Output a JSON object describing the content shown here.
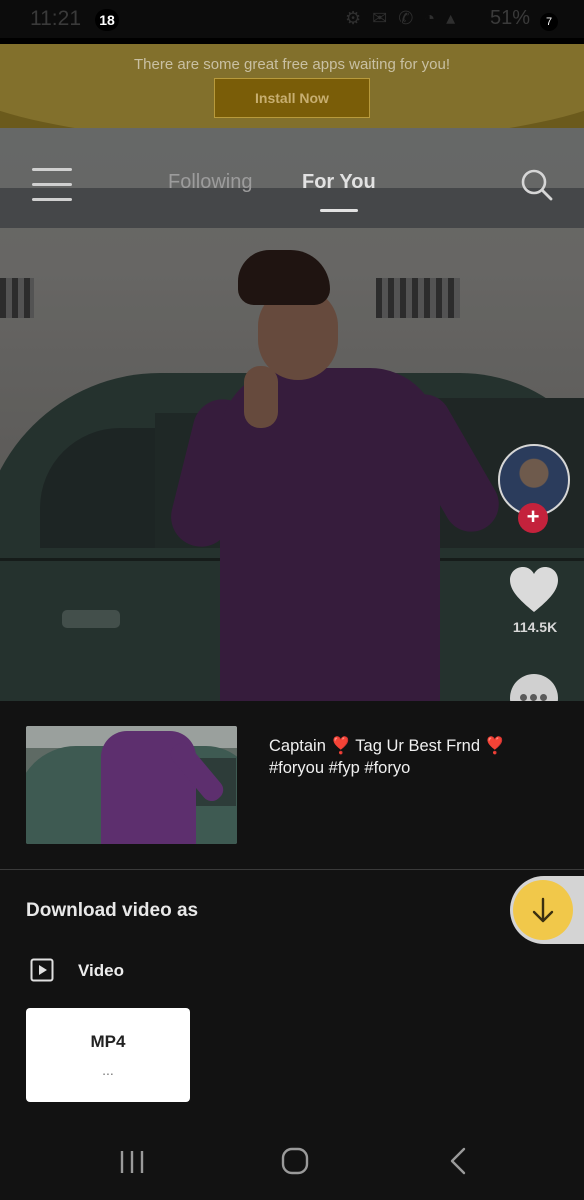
{
  "status_bar": {
    "time": "11:21",
    "notification_count": "18",
    "battery": "51%",
    "battery_badge": "7"
  },
  "banner": {
    "message": "There are some great free apps waiting for you!",
    "button_label": "Install Now"
  },
  "feed": {
    "tabs": [
      {
        "label": "Following",
        "active": false
      },
      {
        "label": "For You",
        "active": true
      }
    ],
    "like_count": "114.5K"
  },
  "download_sheet": {
    "caption_line1": "Captain ❣️ Tag Ur Best Frnd ❣️",
    "caption_line2": "#foryou #fyp #foryo",
    "title": "Download video as",
    "section_label": "Video",
    "format_label": "MP4",
    "format_sub": "..."
  },
  "colors": {
    "accent": "#f1c84a",
    "banner": "#6b5a1c",
    "follow": "#c4223c",
    "background": "#121212"
  },
  "icons": [
    "menu-icon",
    "search-icon",
    "heart-icon",
    "comment-icon",
    "plus-icon",
    "download-arrow-icon",
    "play-icon",
    "recent-apps-icon",
    "home-icon",
    "back-icon"
  ]
}
